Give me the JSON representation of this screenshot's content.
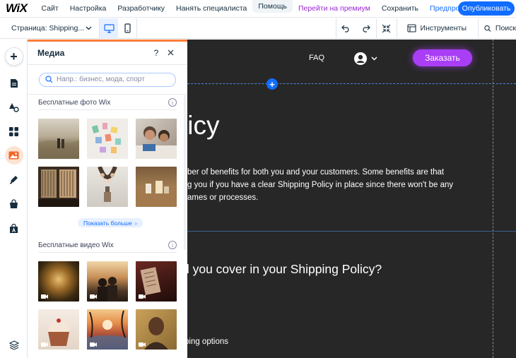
{
  "topbar": {
    "logo": "WiX",
    "menu": [
      "Сайт",
      "Настройка",
      "Разработчику",
      "Нанять специалиста",
      "Помощь",
      "Перейти на премиум",
      "Сохранить",
      "Предпросмотр"
    ],
    "publish": "Опубликовать"
  },
  "subbar": {
    "page_selector": "Страница: Shipping...",
    "tools": "Инструменты",
    "search": "Поиск"
  },
  "rail": {
    "items": [
      "add-icon",
      "pages-icon",
      "design-icon",
      "apps-icon",
      "media-icon",
      "blog-icon",
      "store-icon",
      "bookings-icon",
      "layers-icon"
    ]
  },
  "panel": {
    "title": "Медиа",
    "search_placeholder": "Напр.: бизнес, мода, спорт",
    "photos_title": "Бесплатные фото Wix",
    "show_more": "Показать больше",
    "videos_title": "Бесплатные видео Wix"
  },
  "canvas": {
    "nav_faq": "FAQ",
    "order_button": "Заказать",
    "heading": "licy",
    "body_lines": [
      "ber of benefits for both you and your customers. Some benefits are that",
      "g you if you have a clear Shipping Policy in place since there won't be any",
      "ames or processes."
    ],
    "subheading": "d you cover in your Shipping Policy?",
    "last_line": "ping options"
  },
  "colors": {
    "accent_blue": "#116dff",
    "premium_purple": "#9a27d5",
    "panel_accent": "#ff7d38",
    "order_button": "#a93ef6",
    "canvas_bg": "#272727"
  }
}
